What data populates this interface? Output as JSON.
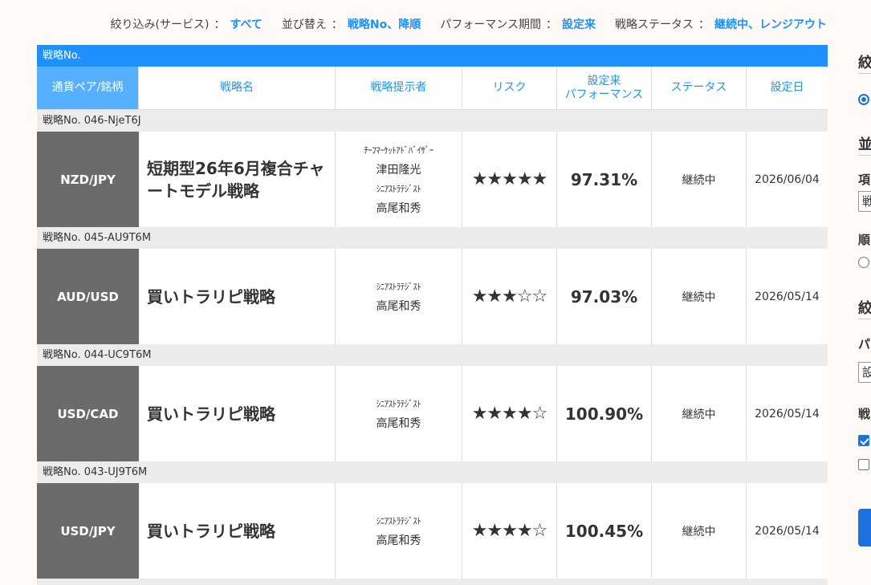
{
  "filters": {
    "service_label": "絞り込み(サービス)",
    "service_value": "すべて",
    "sort_label": "並び替え",
    "sort_value": "戦略No、降順",
    "period_label": "パフォーマンス期間",
    "period_value": "設定来",
    "status_label": "戦略ステータス",
    "status_value": "継続中、レンジアウト",
    "separator": "："
  },
  "table": {
    "caption": "戦略No.",
    "headers": {
      "pair": "通貨ペア/銘柄",
      "name": "戦略名",
      "provider": "戦略提示者",
      "risk": "リスク",
      "performance_line1": "設定来",
      "performance_line2": "パフォーマンス",
      "status": "ステータス",
      "date": "設定日"
    },
    "rows": [
      {
        "code": "戦略No. 046-NjeT6J",
        "pair": "NZD/JPY",
        "name": "短期型26年6月複合チャートモデル戦略",
        "provider_title1": "ﾁｰﾌﾏｰｹｯﾄｱﾄﾞﾊﾞｲｻﾞｰ",
        "provider_name1": "津田隆光",
        "provider_title2": "ｼﾆｱｽﾄﾗﾃｼﾞｽﾄ",
        "provider_name2": "高尾和秀",
        "risk": "★★★★★",
        "performance": "97.31%",
        "status": "継続中",
        "date": "2026/06/04"
      },
      {
        "code": "戦略No. 045-AU9T6M",
        "pair": "AUD/USD",
        "name": "買いトラリピ戦略",
        "provider_title2": "ｼﾆｱｽﾄﾗﾃｼﾞｽﾄ",
        "provider_name2": "高尾和秀",
        "risk": "★★★☆☆",
        "performance": "97.03%",
        "status": "継続中",
        "date": "2026/05/14"
      },
      {
        "code": "戦略No. 044-UC9T6M",
        "pair": "USD/CAD",
        "name": "買いトラリピ戦略",
        "provider_title2": "ｼﾆｱｽﾄﾗﾃｼﾞｽﾄ",
        "provider_name2": "高尾和秀",
        "risk": "★★★★☆",
        "performance": "100.90%",
        "status": "継続中",
        "date": "2026/05/14"
      },
      {
        "code": "戦略No. 043-UJ9T6M",
        "pair": "USD/JPY",
        "name": "買いトラリピ戦略",
        "provider_title2": "ｼﾆｱｽﾄﾗﾃｼﾞｽﾄ",
        "provider_name2": "高尾和秀",
        "risk": "★★★★☆",
        "performance": "100.45%",
        "status": "継続中",
        "date": "2026/05/14"
      }
    ]
  },
  "sidebar": {
    "filter_head": "絞",
    "sort_head": "並",
    "item_label": "項",
    "item_select": "戦",
    "order_label": "順",
    "filter_head2": "絞",
    "period_label": "パ",
    "period_select": "設",
    "status_label": "戦"
  },
  "colors": {
    "accent": "#1e90ff",
    "header_pair_bg": "#55b0ff",
    "pair_cell_bg": "#6b6b6b",
    "code_row_bg": "#ececec"
  }
}
